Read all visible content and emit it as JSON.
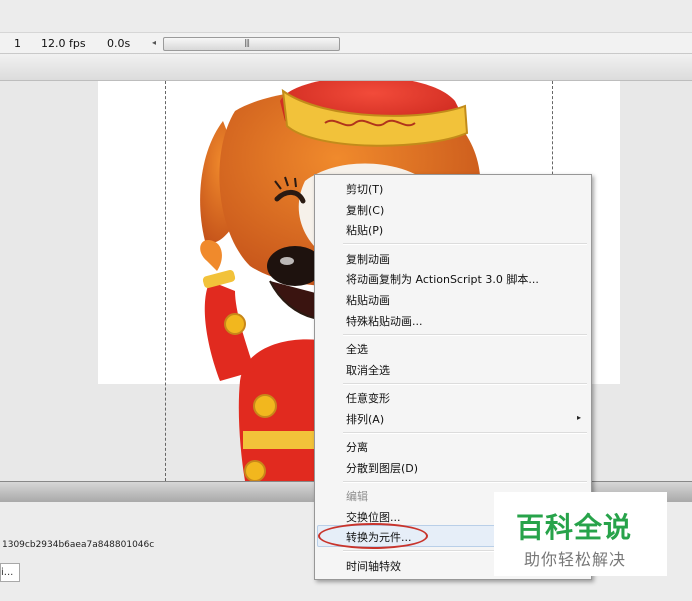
{
  "timeline": {
    "frame": "1",
    "fps": "12.0 fps",
    "time": "0.0s",
    "scroll_left_glyph": "◂",
    "scroll_grip_glyph": "|||"
  },
  "properties_panel": {
    "hash_text": "1309cb2934b6aea7a848801046c",
    "field_text": "i..."
  },
  "context_menu": {
    "group1": [
      "剪切(T)",
      "复制(C)",
      "粘贴(P)"
    ],
    "group2": [
      "复制动画",
      "将动画复制为 ActionScript 3.0 脚本...",
      "粘贴动画",
      "特殊粘贴动画..."
    ],
    "group3": [
      "全选",
      "取消全选"
    ],
    "group4": [
      "任意变形",
      "排列(A)"
    ],
    "group5": [
      "分离",
      "分散到图层(D)"
    ],
    "group6": [
      "编辑",
      "交换位图...",
      "转换为元件..."
    ],
    "group7": [
      "时间轴特效"
    ],
    "submenu_arrow": "▸",
    "highlighted_item": "转换为元件...",
    "highlight_color": "#c8342c"
  },
  "watermark": {
    "title": "百科全说",
    "subtitle": "助你轻松解决",
    "title_color": "#27a34a"
  }
}
